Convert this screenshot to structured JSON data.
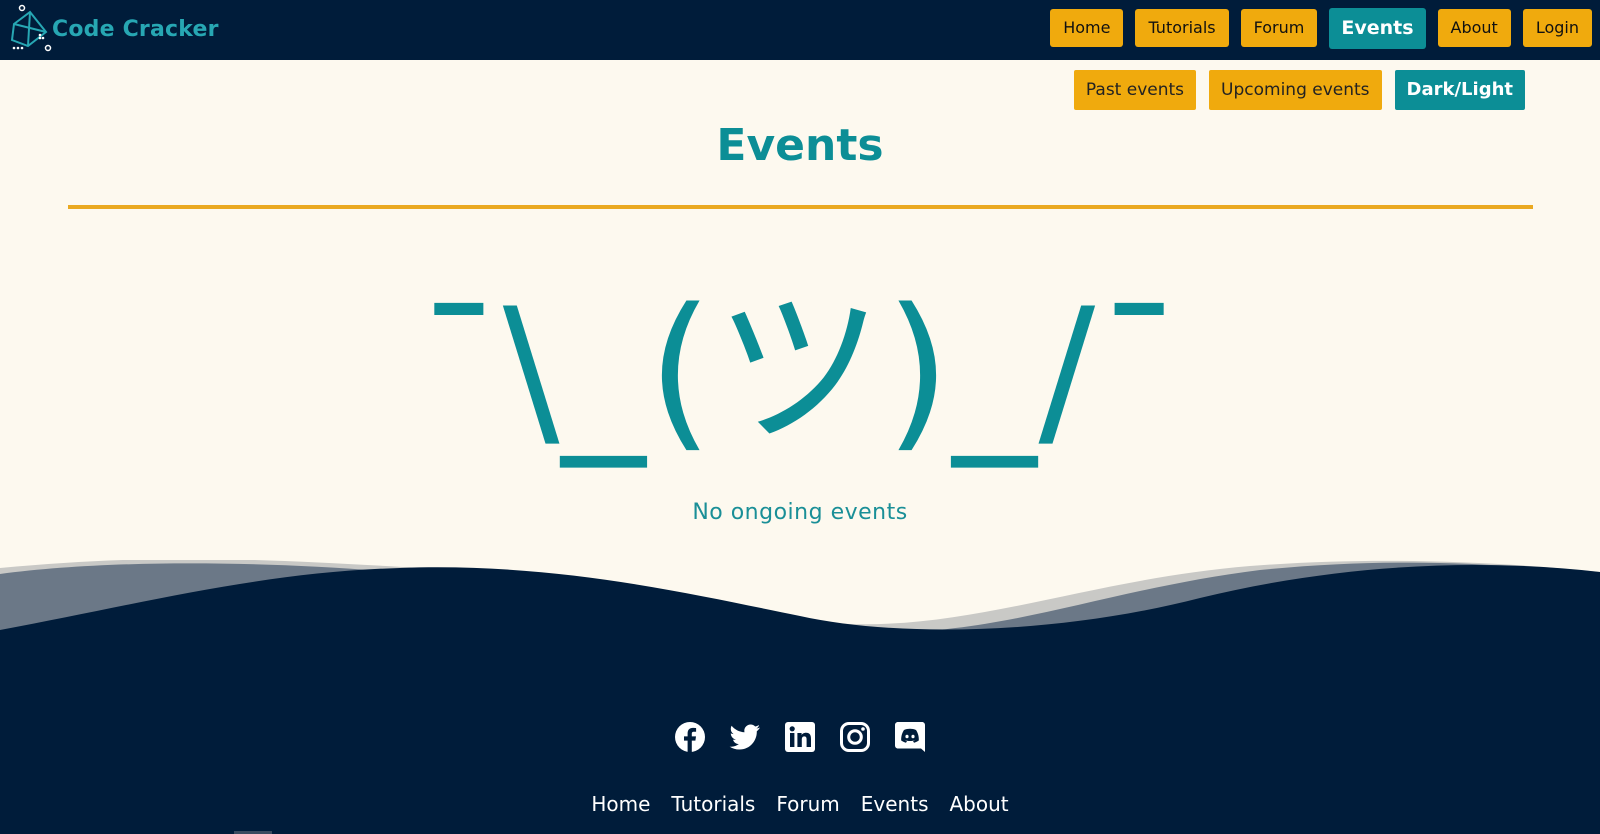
{
  "brand": {
    "name": "Code Cracker",
    "logo_icon": "code-cracker-logo"
  },
  "nav": {
    "items": [
      {
        "label": "Home"
      },
      {
        "label": "Tutorials"
      },
      {
        "label": "Forum"
      },
      {
        "label": "Events",
        "active": true
      },
      {
        "label": "About"
      },
      {
        "label": "Login"
      }
    ]
  },
  "filters": {
    "past": "Past events",
    "upcoming": "Upcoming events",
    "theme_toggle": "Dark/Light"
  },
  "page": {
    "title": "Events",
    "empty_emoticon": "¯\\_(ツ)_/¯",
    "empty_message": "No ongoing events"
  },
  "footer": {
    "social": [
      {
        "icon": "facebook-icon"
      },
      {
        "icon": "twitter-icon"
      },
      {
        "icon": "linkedin-icon"
      },
      {
        "icon": "instagram-icon"
      },
      {
        "icon": "discord-icon"
      }
    ],
    "links": [
      {
        "label": "Home"
      },
      {
        "label": "Tutorials"
      },
      {
        "label": "Forum"
      },
      {
        "label": "Events"
      },
      {
        "label": "About"
      }
    ]
  },
  "colors": {
    "navbar_bg": "#001c3a",
    "accent_gold": "#f0aa0d",
    "accent_teal": "#0c8e96",
    "page_bg": "#fdf9ef"
  }
}
